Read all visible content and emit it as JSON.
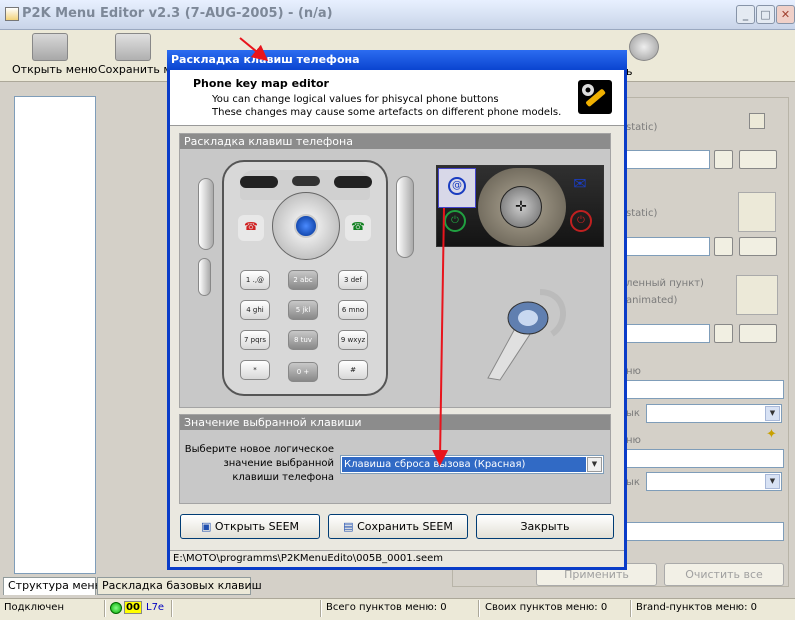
{
  "window": {
    "title": "P2K Menu Editor v2.3 (7-AUG-2005) - (n/a)"
  },
  "toolbar": {
    "open_label": "Открыть меню",
    "save_label": "Сохранить ме",
    "last_label": "ь"
  },
  "tabs": [
    "Структура меню",
    "Раскладка базовых клавиш"
  ],
  "status": {
    "connection": "Подключен",
    "indicator": "00",
    "id": "L7e",
    "total_items": "Всего пунктов меню: 0",
    "own_items": "Своих пунктов меню: 0",
    "brand_items": "Brand-пунктов меню: 0"
  },
  "right_panel": {
    "label_static_1": "static)",
    "label_static_2": "static)",
    "label_selected": "ленный пункт)",
    "label_animated": "animated)",
    "label_nu_1": "ню",
    "label_yk_1": "ык",
    "label_nu_2": "ню",
    "label_yk_2": "ык",
    "apply_label": "Применить",
    "clear_label": "Очистить все"
  },
  "dialog": {
    "title": "Раскладка клавиш телефона",
    "heading": "Phone key map editor",
    "desc1": "You can change logical values for phisycal phone buttons",
    "desc2": "These changes may cause some artefacts on different phone models.",
    "keymap_section": "Раскладка клавиш телефона",
    "value_section": "Значение выбранной клавиши",
    "prompt": [
      "Выберите новое логическое",
      "значение выбранной",
      "клавиши телефона"
    ],
    "selected_value": "Клавиша сброса вызова (Красная)",
    "open_seem": "Открыть SEEM",
    "save_seem": "Сохранить SEEM",
    "close": "Закрыть",
    "path": "E:\\MOTO\\programms\\P2KMenuEdito\\005B_0001.seem",
    "keys": [
      "1 .,@",
      "2 abc",
      "3 def",
      "4 ghi",
      "5 jkl",
      "6 mno",
      "7 pqrs",
      "8 tuv",
      "9 wxyz",
      "*",
      "0 +",
      "#"
    ]
  },
  "colors": {
    "accent": "#0a44d0",
    "annotation": "#e8141c"
  }
}
